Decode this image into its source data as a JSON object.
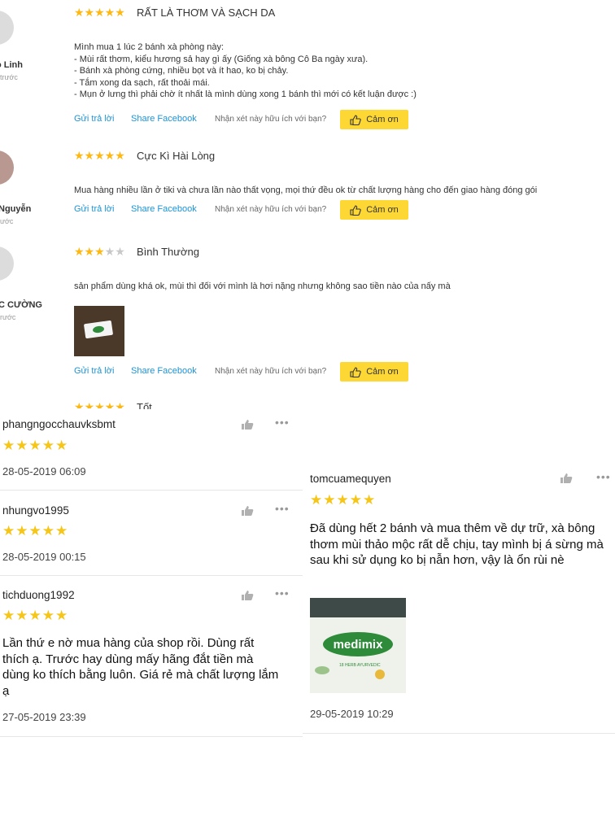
{
  "top": {
    "reviews": [
      {
        "user": "o Linh",
        "ago": "trước",
        "title": "RẤT LÀ THƠM VÀ SẠCH DA",
        "rating": 5,
        "lines": [
          "Mình mua 1 lúc 2 bánh xà phòng này:",
          "- Mùi rất thơm, kiểu hương sả hay gì ấy (Giống xà bông Cô Ba ngày xưa).",
          "- Bánh xà phòng cứng, nhiều bọt và ít hao, ko bị chảy.",
          "- Tắm xong da sạch, rất thoải mái.",
          "- Mụn ở lưng thì phải chờ ít nhất là mình dùng xong 1 bánh thì mới có kết luận được :)"
        ]
      },
      {
        "user": "Nguyễn",
        "ago": "ước",
        "title": "Cực Kì Hài Lòng",
        "rating": 5,
        "lines": [
          "Mua hàng nhiều lần ở tiki và chưa lần nào thất vọng, mọi thứ đều ok từ chất lượng hàng cho đến giao hàng đóng gói"
        ]
      },
      {
        "user": "C CƯỜNG",
        "ago": "rước",
        "title": "Bình Thường",
        "rating": 3,
        "lines": [
          "sản phẩm dùng khá ok, mùi thì đối với mình là hơi nặng nhưng không sao tiền nào của nấy mà"
        ]
      },
      {
        "user": "",
        "ago": "",
        "title": "Tốt",
        "rating": 5,
        "lines": []
      }
    ],
    "reply_label": "Gửi trả lời",
    "share_label": "Share Facebook",
    "helpful_label": "Nhận xét này hữu ích với bạn?",
    "thanks_label": "Cảm ơn"
  },
  "bottom_left": [
    {
      "user": "phangngocchauvksbmt",
      "date": "28-05-2019 06:09",
      "text": ""
    },
    {
      "user": "nhungvo1995",
      "date": "28-05-2019 00:15",
      "text": ""
    },
    {
      "user": "tichduong1992",
      "date": "27-05-2019 23:39",
      "text": "Lần thứ e nờ mua hàng của shop rồi. Dùng rất thích ạ. Trước hay dùng mấy hãng đắt tiền mà dùng ko thích bằng luôn. Giá rẻ mà chất lượng lắm ạ"
    }
  ],
  "bottom_right": {
    "user": "tomcuamequyen",
    "date": "29-05-2019 10:29",
    "text": "Đã dùng hết 2 bánh và mua thêm về dự trữ, xà bông thơm mùi thảo mộc rất dễ chịu, tay mình bị á sừng mà sau khi sử dụng ko bị nẫn hơn, vậy là ổn rùi nè",
    "product_brand": "medimix",
    "product_sub": "18 HERB AYURVEDIC"
  },
  "colors": {
    "star": "#fdb813",
    "link": "#1a94d8",
    "thanks_bg": "#fdd835",
    "brand_green": "#2e8b3a"
  }
}
